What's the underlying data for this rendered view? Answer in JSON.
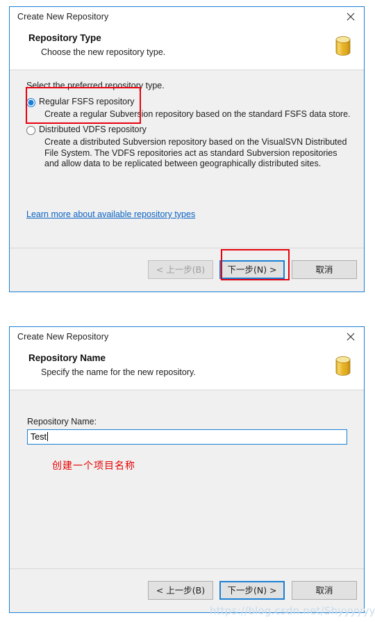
{
  "dialog1": {
    "title": "Create New Repository",
    "close_icon": "close-icon",
    "header": {
      "title": "Repository Type",
      "subtitle": "Choose the new repository type.",
      "icon": "database-cylinder-icon"
    },
    "intro": "Select the preferred repository type.",
    "options": [
      {
        "label": "Regular FSFS repository",
        "description": "Create a regular Subversion repository based on the standard FSFS data store.",
        "selected": true
      },
      {
        "label": "Distributed VDFS repository",
        "description": "Create a distributed Subversion repository based on the VisualSVN Distributed File System. The VDFS repositories act as standard Subversion repositories and allow data to be replicated between geographically distributed sites.",
        "selected": false
      }
    ],
    "link": "Learn more about available repository types",
    "buttons": {
      "back": "< 上一步(B)",
      "next": "下一步(N) >",
      "cancel": "取消",
      "back_disabled": true,
      "next_default": true
    }
  },
  "dialog2": {
    "title": "Create New Repository",
    "close_icon": "close-icon",
    "header": {
      "title": "Repository Name",
      "subtitle": "Specify the name for the new repository.",
      "icon": "database-cylinder-icon"
    },
    "field": {
      "label": "Repository Name:",
      "value": "Test",
      "placeholder": ""
    },
    "annotation": "创建一个项目名称",
    "buttons": {
      "back": "< 上一步(B)",
      "next": "下一步(N) >",
      "cancel": "取消",
      "back_disabled": false,
      "next_default": true
    }
  },
  "annotations": {
    "colors": {
      "red_box": "#e8000d",
      "red_text": "#e60000",
      "accent_blue": "#1a7fd4",
      "link_blue": "#0b63c5",
      "icon_gold": "#e8b923"
    }
  },
  "watermark": "https://blog.csdn.net/Shyyyyyy"
}
